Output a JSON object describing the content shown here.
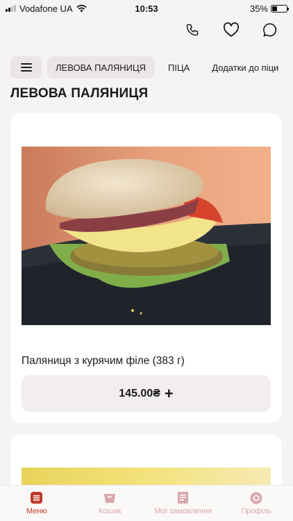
{
  "status_bar": {
    "carrier": "Vodafone UA",
    "time": "10:53",
    "battery": "35%",
    "battery_level": 0.35
  },
  "top_actions": [
    {
      "name": "phone-icon"
    },
    {
      "name": "heart-icon"
    },
    {
      "name": "chat-icon"
    }
  ],
  "categories": {
    "active_index": 0,
    "items": [
      {
        "label": "ЛЕВОВА ПАЛЯНИЦЯ"
      },
      {
        "label": "ПІЦА"
      },
      {
        "label": "Додатки до піци"
      }
    ]
  },
  "section_title": "ЛЕВОВА ПАЛЯНИЦЯ",
  "products": [
    {
      "name": "Паляниця з курячим філе (383 г)",
      "price": "145.00₴",
      "add_symbol": "+"
    }
  ],
  "tabbar": {
    "items": [
      {
        "label": "Меню",
        "icon": "menu-icon",
        "active": true
      },
      {
        "label": "Кошик",
        "icon": "cart-icon",
        "active": false
      },
      {
        "label": "Мої замовлення",
        "icon": "orders-icon",
        "active": false
      },
      {
        "label": "Профіль",
        "icon": "profile-icon",
        "active": false
      }
    ]
  },
  "colors": {
    "accent": "#c0392b",
    "inactive_tab": "#d9a8ad",
    "background": "#f6f3f3",
    "card": "#ffffff"
  }
}
